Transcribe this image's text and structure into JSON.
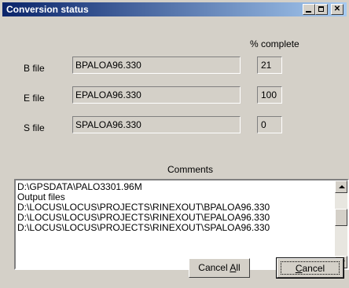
{
  "window": {
    "title": "Conversion status"
  },
  "progress": {
    "header": "% complete",
    "rows": [
      {
        "label": "B file",
        "filename": "BPALOA96.330",
        "percent": "21"
      },
      {
        "label": "E file",
        "filename": "EPALOA96.330",
        "percent": "100"
      },
      {
        "label": "S file",
        "filename": "SPALOA96.330",
        "percent": "0"
      }
    ]
  },
  "comments": {
    "label": "Comments",
    "lines": [
      "D:\\GPSDATA\\PALO3301.96M",
      "Output files",
      "D:\\LOCUS\\LOCUS\\PROJECTS\\RINEXOUT\\BPALOA96.330",
      "D:\\LOCUS\\LOCUS\\PROJECTS\\RINEXOUT\\EPALOA96.330",
      "D:\\LOCUS\\LOCUS\\PROJECTS\\RINEXOUT\\SPALOA96.330"
    ]
  },
  "buttons": {
    "cancel_all_prefix": "Cancel ",
    "cancel_all_accel": "A",
    "cancel_all_suffix": "ll",
    "cancel_accel": "C",
    "cancel_suffix": "ancel"
  }
}
